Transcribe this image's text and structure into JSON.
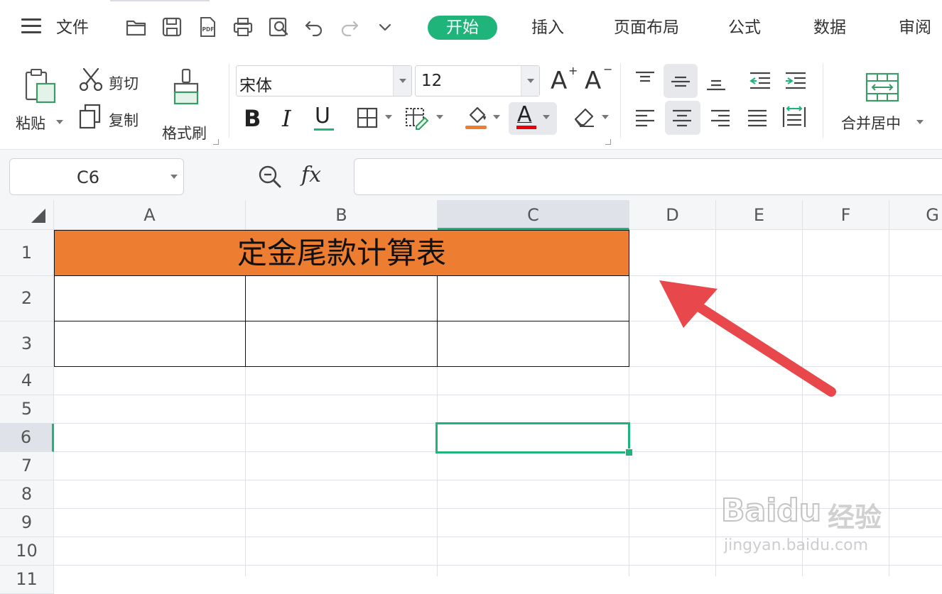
{
  "menu": {
    "file_label": "文件"
  },
  "tabs": [
    {
      "label": "开始",
      "active": true
    },
    {
      "label": "插入"
    },
    {
      "label": "页面布局"
    },
    {
      "label": "公式"
    },
    {
      "label": "数据"
    },
    {
      "label": "审阅"
    }
  ],
  "clipboard": {
    "paste_label": "粘贴",
    "cut_label": "剪切",
    "copy_label": "复制",
    "format_painter_label": "格式刷"
  },
  "font": {
    "name": "宋体",
    "size": "12",
    "increase_label": "A",
    "decrease_label": "A",
    "bold_label": "B",
    "italic_label": "I",
    "underline_label": "U",
    "font_color_label": "A"
  },
  "colors": {
    "accent": "#1fb57a",
    "title_fill": "#ed7d31",
    "fill_bar": "#ed7d31",
    "font_bar": "#e8000b",
    "arrow": "#e8474b"
  },
  "align": {
    "merge_label": "合并居中"
  },
  "formula": {
    "name_box": "C6",
    "fx_label": "fx",
    "value": ""
  },
  "sheet": {
    "columns": [
      "A",
      "B",
      "C",
      "D",
      "E",
      "F",
      "G"
    ],
    "rows": [
      "1",
      "2",
      "3",
      "4",
      "5",
      "6",
      "7",
      "8",
      "9",
      "10",
      "11"
    ],
    "selected_column": "C",
    "selected_row": "6",
    "title_cell": "定金尾款计算表"
  },
  "watermark": {
    "brand": "Baidu",
    "brand_cn": "经验",
    "url": "jingyan.baidu.com"
  }
}
